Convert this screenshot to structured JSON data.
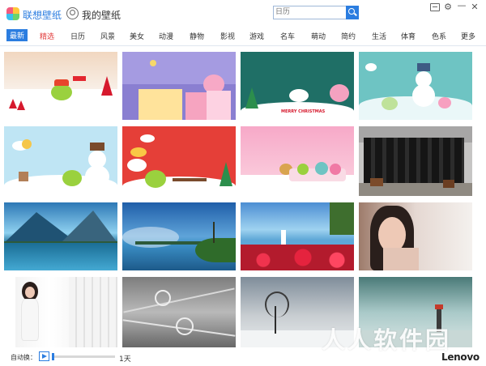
{
  "app": {
    "tabs": [
      {
        "label": "联想壁纸",
        "icon": "app-logo-icon",
        "active": true
      },
      {
        "label": "我的壁纸",
        "icon": "user-icon",
        "active": false
      }
    ],
    "search_placeholder": "日历",
    "window_controls": [
      "menu-icon",
      "gear-icon",
      "minimize-icon",
      "close-icon"
    ]
  },
  "categories": [
    {
      "label": "最新",
      "active": true
    },
    {
      "label": "精选",
      "hot": true
    },
    {
      "label": "日历"
    },
    {
      "label": "风景"
    },
    {
      "label": "美女"
    },
    {
      "label": "动漫"
    },
    {
      "label": "静物"
    },
    {
      "label": "影视"
    },
    {
      "label": "游戏"
    },
    {
      "label": "名车"
    },
    {
      "label": "萌动"
    },
    {
      "label": "简约"
    },
    {
      "label": "生活"
    },
    {
      "label": "体育"
    },
    {
      "label": "色系"
    },
    {
      "label": "更多"
    }
  ],
  "wallpapers": [
    {
      "theme": "christmas-snow-cartoon"
    },
    {
      "theme": "purple-town-christmas"
    },
    {
      "theme": "merry-christmas-teal",
      "caption": "MERRY CHRISTMAS"
    },
    {
      "theme": "snowman-teal"
    },
    {
      "theme": "snowman-blue"
    },
    {
      "theme": "sleigh-red"
    },
    {
      "theme": "pink-sleigh-reindeer"
    },
    {
      "theme": "group-photo-dark"
    },
    {
      "theme": "mountain-lake"
    },
    {
      "theme": "blue-lake-island"
    },
    {
      "theme": "red-flowers-lake"
    },
    {
      "theme": "portrait-girl"
    },
    {
      "theme": "white-curtain-girl"
    },
    {
      "theme": "barbed-wire"
    },
    {
      "theme": "frozen-tree"
    },
    {
      "theme": "lighthouse-mist"
    }
  ],
  "footer": {
    "auto_switch_label": "自动换：",
    "interval_label": "1天",
    "brand": "Lenovo"
  },
  "watermark": "人人软件园"
}
